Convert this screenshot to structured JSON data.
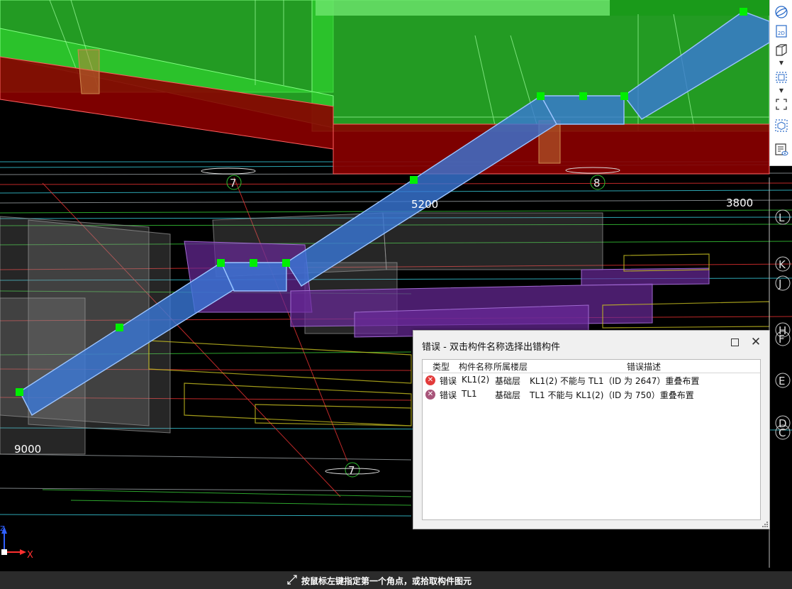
{
  "viewport": {
    "dimension_labels": [
      "5200",
      "3800",
      "9000"
    ],
    "axis_numbers": [
      "7",
      "8",
      "7"
    ],
    "axis_letters": [
      "L",
      "K",
      "J",
      "H",
      "F",
      "E",
      "D",
      "C"
    ],
    "coordinate_axes": {
      "x": "X",
      "z": "Z"
    }
  },
  "toolbar": {
    "buttons": [
      "perspective-icon",
      "2d-view-icon",
      "3d-cube-icon",
      "partial-view-icon",
      "fullscreen-icon",
      "box-view-icon",
      "property-display-icon"
    ]
  },
  "dialog": {
    "title": "错误 - 双击构件名称选择出错构件",
    "columns": {
      "type": "类型",
      "name": "构件名称",
      "floor": "所属楼层",
      "desc": "错误描述"
    },
    "rows": [
      {
        "type": "错误",
        "name": "KL1(2)",
        "floor": "基础层",
        "desc": "KL1(2) 不能与 TL1（ID 为 2647）重叠布置",
        "icon_color": "#e23b3b"
      },
      {
        "type": "错误",
        "name": "TL1",
        "floor": "基础层",
        "desc": "TL1 不能与 KL1(2)（ID 为 750）重叠布置",
        "icon_color": "#a8557a"
      }
    ]
  },
  "statusbar": {
    "text": "按鼠标左键指定第一个角点，或拾取构件图元"
  }
}
